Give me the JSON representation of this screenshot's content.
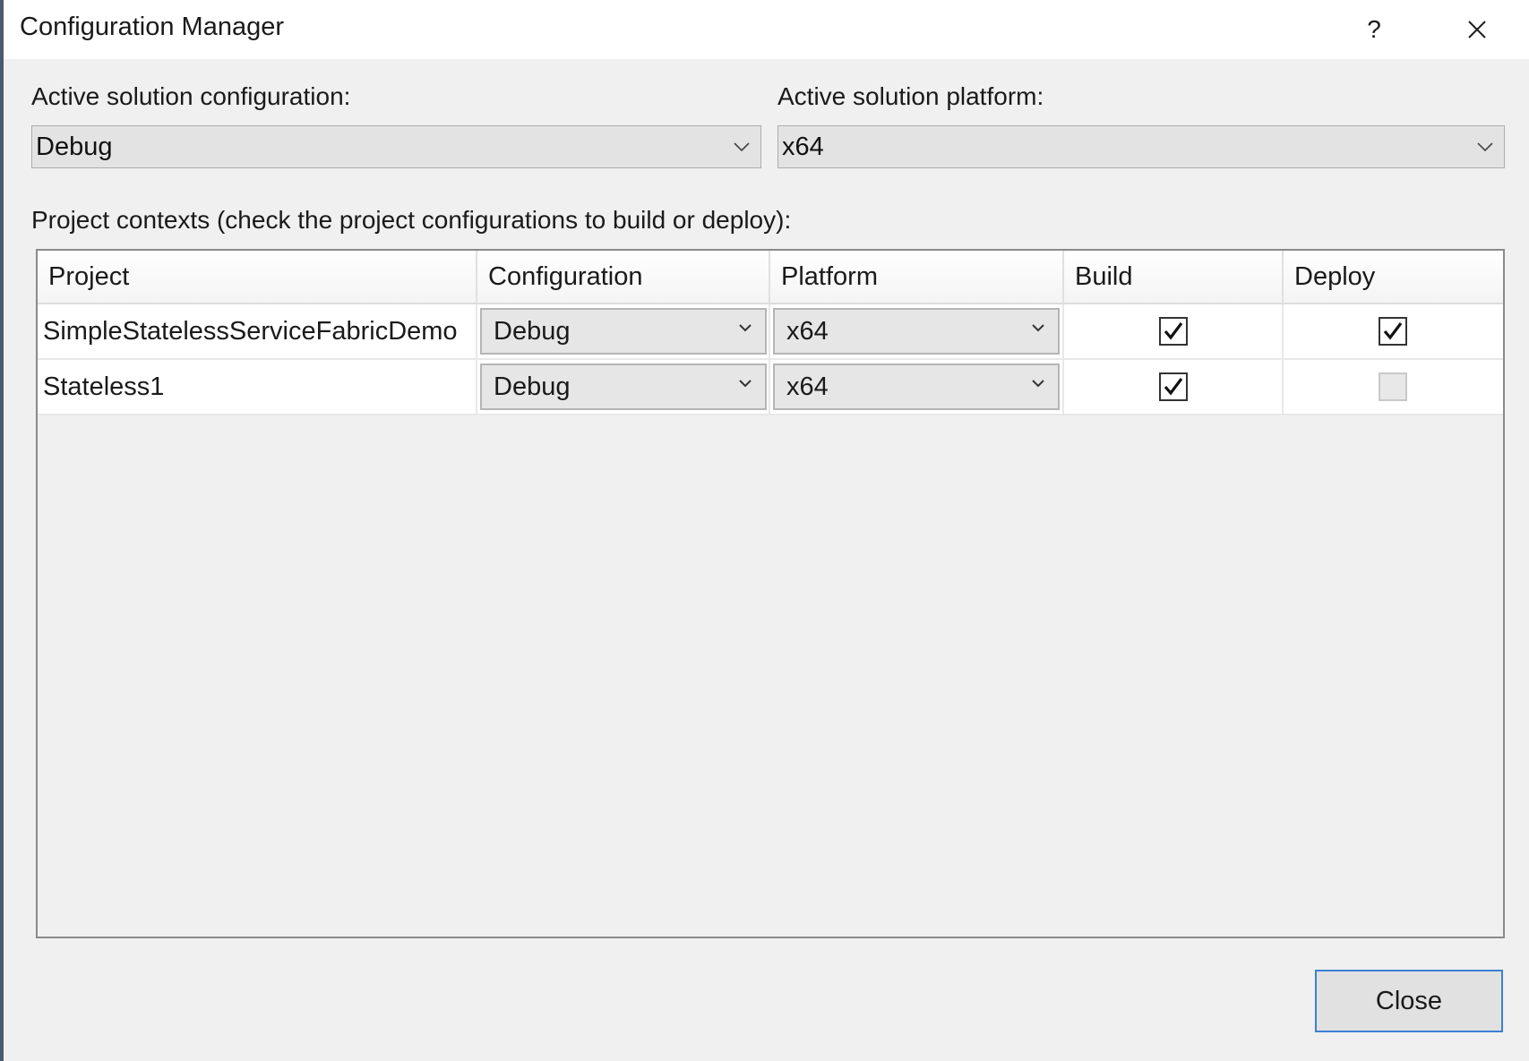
{
  "window": {
    "title": "Configuration Manager",
    "help_label": "?"
  },
  "active": {
    "config_label": "Active solution configuration:",
    "config_value": "Debug",
    "platform_label": "Active solution platform:",
    "platform_value": "x64"
  },
  "contexts_label": "Project contexts (check the project configurations to build or deploy):",
  "grid": {
    "headers": [
      "Project",
      "Configuration",
      "Platform",
      "Build",
      "Deploy"
    ],
    "rows": [
      {
        "project": "SimpleStatelessServiceFabricDemo",
        "configuration": "Debug",
        "platform": "x64",
        "build": true,
        "deploy": true
      },
      {
        "project": "Stateless1",
        "configuration": "Debug",
        "platform": "x64",
        "build": true,
        "deploy": false
      }
    ]
  },
  "footer": {
    "close_label": "Close"
  },
  "icons": {
    "close": "close-icon",
    "chevron": "chevron-down-icon",
    "check": "checkmark-icon"
  },
  "colors": {
    "accent": "#3d7fd6",
    "dialog_bg": "#f0f0f0"
  }
}
